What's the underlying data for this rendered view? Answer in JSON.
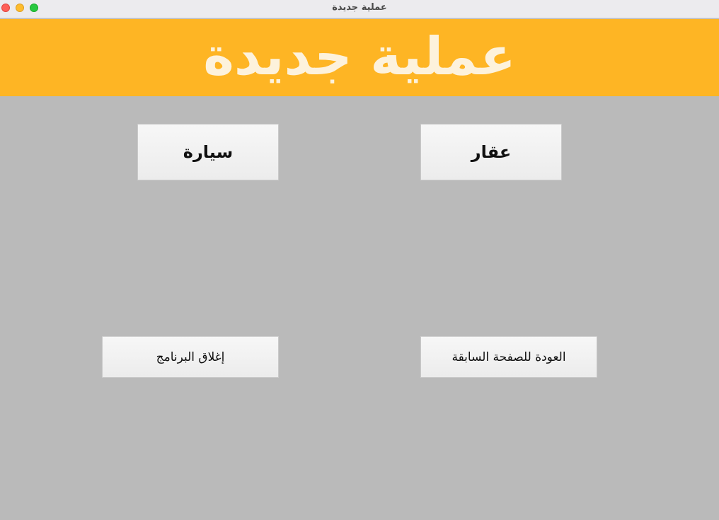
{
  "window": {
    "title": "عملية جديدة"
  },
  "banner": {
    "title": "عملية جديدة",
    "background_color": "#feb524",
    "text_color": "#fdf2dc"
  },
  "buttons": {
    "car": "سيارة",
    "real_estate": "عقار",
    "exit": "إغلاق البرنامج",
    "back": "العودة للصفحة السابقة"
  },
  "colors": {
    "content_background": "#bababa",
    "button_background": "#f2f2f2"
  }
}
